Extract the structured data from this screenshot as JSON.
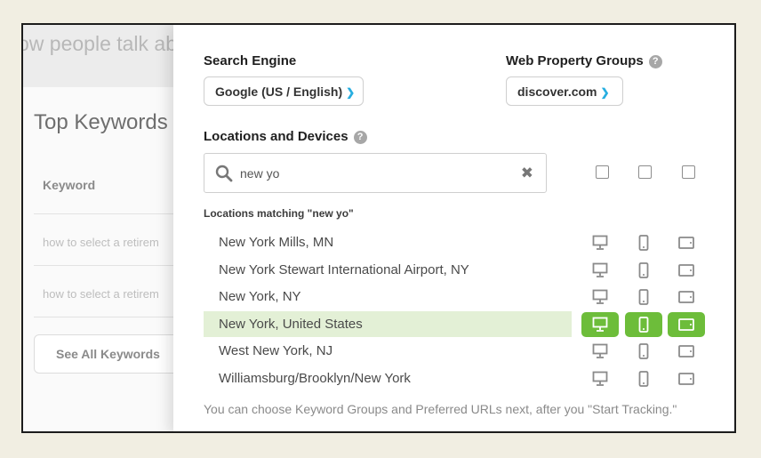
{
  "background": {
    "hero_text": "ow people talk ab",
    "section_title": "Top Keywords",
    "column_header": "Keyword",
    "rows": [
      "how to select a retirem",
      "how to select a retirem"
    ],
    "see_all_button": "See All Keywords"
  },
  "modal": {
    "search_engine": {
      "label": "Search Engine",
      "selected": "Google (US / English)"
    },
    "property_groups": {
      "label": "Web Property Groups",
      "selected": "discover.com"
    },
    "locations": {
      "label": "Locations and Devices",
      "query": "new yo",
      "matching_label": "Locations matching \"new yo\"",
      "results": [
        {
          "name": "New York Mills, MN",
          "selected": false
        },
        {
          "name": "New York Stewart International Airport, NY",
          "selected": false
        },
        {
          "name": "New York, NY",
          "selected": false
        },
        {
          "name": "New York, United States",
          "selected": true
        },
        {
          "name": "West New York, NJ",
          "selected": false
        },
        {
          "name": "Williamsburg/Brooklyn/New York",
          "selected": false
        }
      ]
    },
    "footer_note": "You can choose Keyword Groups and Preferred URLs next, after you \"Start Tracking.\""
  },
  "colors": {
    "accent_chevron": "#27aee0",
    "selected_device": "#6dbd3a",
    "selected_row": "#e3f0d6"
  },
  "icons": [
    "search-icon",
    "clear-icon",
    "help-icon",
    "desktop-icon",
    "phone-icon",
    "tablet-icon",
    "chevron-down-icon"
  ]
}
